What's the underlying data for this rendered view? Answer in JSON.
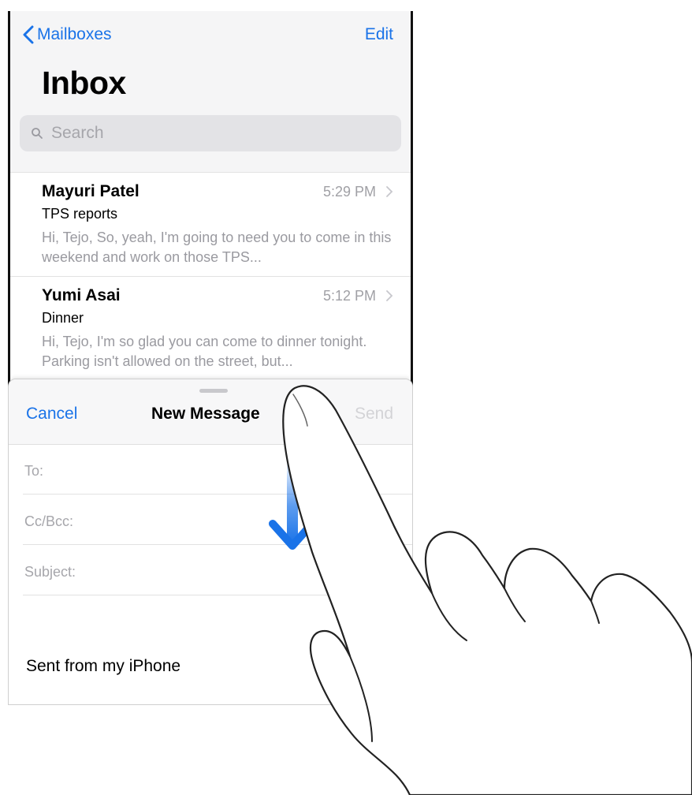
{
  "inbox": {
    "back_label": "Mailboxes",
    "edit_label": "Edit",
    "title": "Inbox",
    "search_placeholder": "Search",
    "messages": [
      {
        "sender": "Mayuri Patel",
        "time": "5:29 PM",
        "subject": "TPS reports",
        "preview": "Hi, Tejo, So, yeah, I'm going to need you to come in this weekend and work on those TPS..."
      },
      {
        "sender": "Yumi Asai",
        "time": "5:12 PM",
        "subject": "Dinner",
        "preview": "Hi, Tejo, I'm so glad you can come to dinner tonight. Parking isn't allowed on the street, but..."
      }
    ]
  },
  "compose": {
    "cancel_label": "Cancel",
    "title": "New Message",
    "send_label": "Send",
    "fields": {
      "to_label": "To:",
      "cc_label": "Cc/Bcc:",
      "subject_label": "Subject:"
    },
    "signature": "Sent from my iPhone"
  },
  "colors": {
    "accent": "#1a73e8",
    "swipe_arrow": "#1a73e8"
  },
  "icons": {
    "back": "chevron-left-icon",
    "search": "search-icon",
    "disclosure": "chevron-right-icon",
    "gesture": "swipe-down-arrow-icon",
    "hand": "pointing-hand-icon"
  }
}
